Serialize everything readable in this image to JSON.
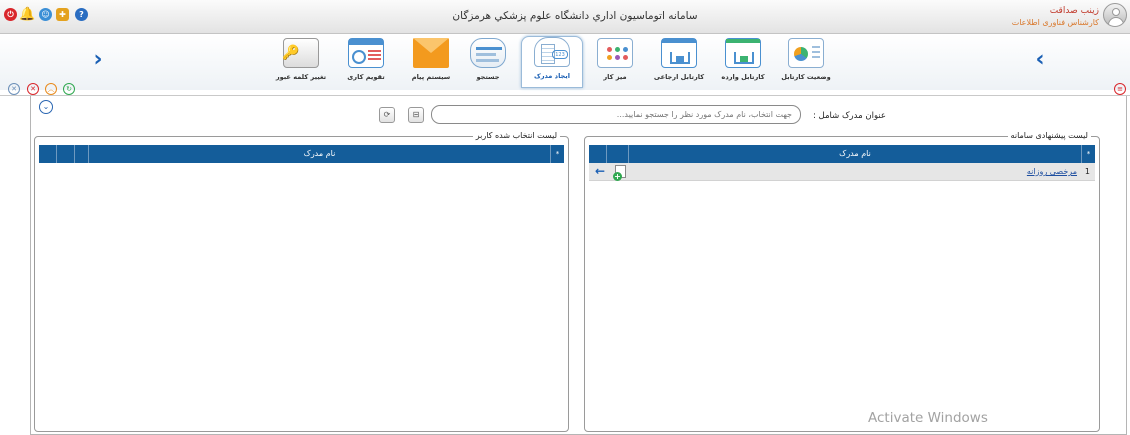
{
  "window": {
    "title": "سامانه اتوماسیون اداري دانشگاه علوم پزشکي هرمزگان"
  },
  "user": {
    "name": "زینب صداقت",
    "role": "کارشناس فناوری اطلاعات"
  },
  "titlebar_icons": [
    "help-icon",
    "puzzle-icon",
    "users-icon",
    "bell-icon",
    "power-icon"
  ],
  "toolbar": {
    "items": [
      {
        "label": "وضعیت کارتابل",
        "icon": "status-chart-icon"
      },
      {
        "label": "کارتابل وارده",
        "icon": "inbox-tray-icon"
      },
      {
        "label": "کارتابل ارجاعی",
        "icon": "referral-tray-icon"
      },
      {
        "label": "میز کار",
        "icon": "desk-icon"
      },
      {
        "label": "ایجاد مدرک",
        "icon": "create-document-icon",
        "active": true
      },
      {
        "label": "جستجو",
        "icon": "search-document-icon"
      },
      {
        "label": "سیستم پیام",
        "icon": "envelope-icon"
      },
      {
        "label": "تقویم کاری",
        "icon": "calendar-icon"
      },
      {
        "label": "تغییر کلمه عبور",
        "icon": "password-key-icon"
      }
    ]
  },
  "search": {
    "label": "عنوان مدرک شامل :",
    "placeholder": "جهت انتخاب، نام مدرک مورد نظر را جستجو نمایید..."
  },
  "suggested_panel": {
    "title": "لیست پیشنهادی سامانه",
    "column_name": "نام مدرک",
    "star": "*",
    "rows": [
      {
        "index": "1",
        "name": "مرخصی روزانه"
      }
    ]
  },
  "selected_panel": {
    "title": "لیست انتخاب شده کاربر",
    "column_name": "نام مدرک",
    "star": "*",
    "rows": []
  },
  "watermark": "Activate Windows",
  "colors": {
    "grid_header": "#145d9a",
    "accent_blue": "#1a5fb4",
    "user_name": "#c0392b",
    "user_role": "#d9772a"
  }
}
